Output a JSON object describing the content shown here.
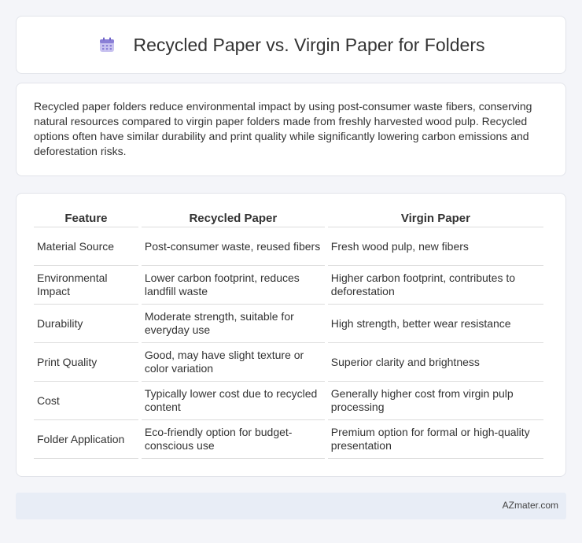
{
  "header": {
    "title": "Recycled Paper vs. Virgin Paper for Folders",
    "icon": "calendar-icon"
  },
  "intro": {
    "text": "Recycled paper folders reduce environmental impact by using post-consumer waste fibers, conserving natural resources compared to virgin paper folders made from freshly harvested wood pulp. Recycled options often have similar durability and print quality while significantly lowering carbon emissions and deforestation risks."
  },
  "table": {
    "headers": [
      "Feature",
      "Recycled Paper",
      "Virgin Paper"
    ],
    "rows": [
      [
        "Material Source",
        "Post-consumer waste, reused fibers",
        "Fresh wood pulp, new fibers"
      ],
      [
        "Environmental Impact",
        "Lower carbon footprint, reduces landfill waste",
        "Higher carbon footprint, contributes to deforestation"
      ],
      [
        "Durability",
        "Moderate strength, suitable for everyday use",
        "High strength, better wear resistance"
      ],
      [
        "Print Quality",
        "Good, may have slight texture or color variation",
        "Superior clarity and brightness"
      ],
      [
        "Cost",
        "Typically lower cost due to recycled content",
        "Generally higher cost from virgin pulp processing"
      ],
      [
        "Folder Application",
        "Eco-friendly option for budget-conscious use",
        "Premium option for formal or high-quality presentation"
      ]
    ]
  },
  "footer": {
    "brand": "AZmater.com"
  },
  "colors": {
    "background": "#f4f5f9",
    "card": "#ffffff",
    "footer": "#e8edf6",
    "icon_accent": "#8a7fd6"
  }
}
